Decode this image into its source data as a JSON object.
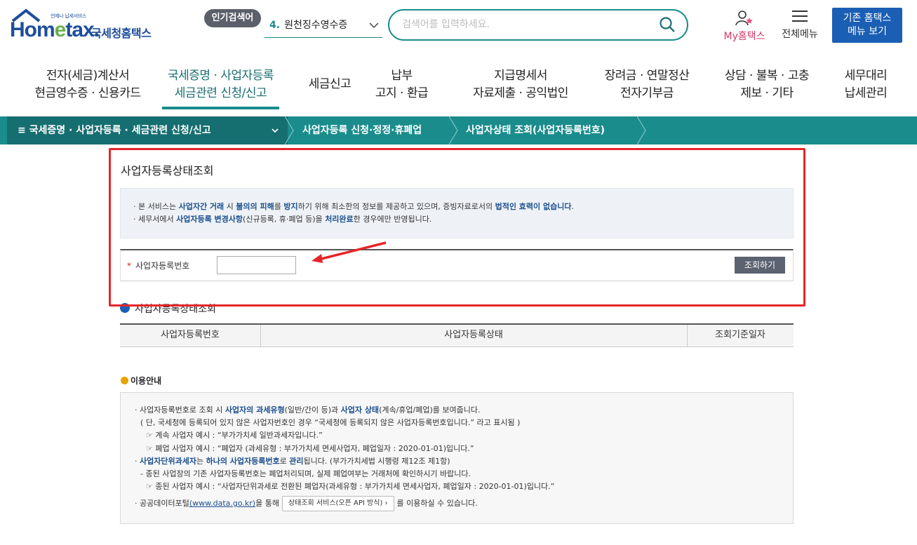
{
  "header": {
    "logo_tag": "언제나 납세서비스",
    "logo_name_1": "Hom",
    "logo_name_e": "e",
    "logo_name_2": "tax.",
    "logo_kr": "국세청홈택스",
    "popular_badge": "인기검색어",
    "popular_rank": "4.",
    "popular_term": "원천징수영수증",
    "search_placeholder": "검색어를 입력하세요.",
    "my_label": "My홈택스",
    "menu_label": "전체메뉴",
    "old_line1": "기존 홈택스",
    "old_line2": "메뉴 보기"
  },
  "nav": [
    {
      "l1": "전자(세금)계산서",
      "l2": "현금영수증 · 신용카드"
    },
    {
      "l1": "국세증명 · 사업자등록",
      "l2": "세금관련 신청/신고"
    },
    {
      "l1": "세금신고",
      "l2": ""
    },
    {
      "l1": "납부",
      "l2": "고지 · 환급"
    },
    {
      "l1": "지급명세서",
      "l2": "자료제출 · 공익법인"
    },
    {
      "l1": "장려금 · 연말정산",
      "l2": "전자기부금"
    },
    {
      "l1": "상담 · 불복 · 고충",
      "l2": "제보 · 기타"
    },
    {
      "l1": "세무대리",
      "l2": "납세관리"
    }
  ],
  "breadcrumb": {
    "menu": "≡  국세증명 · 사업자등록 · 세금관련 신청/신고",
    "b2": "사업자등록 신청·정정·휴폐업",
    "b3": "사업자상태 조회(사업자등록번호)"
  },
  "panel": {
    "title": "사업자등록상태조회",
    "n1_a": "본 서비스는 ",
    "n1_b": "사업자간 거래",
    "n1_c": " 시 ",
    "n1_d": "불의의 피해",
    "n1_e": "를 ",
    "n1_f": "방지",
    "n1_g": "하기 위해 최소한의 정보를 제공하고 있으며, 증빙자료로서의 ",
    "n1_h": "법적인 효력이 없습니다",
    "n1_i": ".",
    "n2_a": "세무서에서 ",
    "n2_b": "사업자등록 변경사항",
    "n2_c": "(신규등록, 휴·폐업 등)을 ",
    "n2_d": "처리완료",
    "n2_e": "한 경우에만 반영됩니다.",
    "field_label": "사업자등록번호",
    "field_value": "",
    "submit": "조회하기"
  },
  "result": {
    "title": "사업자등록상태조회",
    "headers": [
      "사업자등록번호",
      "사업자등록상태",
      "조회기준일자"
    ]
  },
  "usage": {
    "title": "이용안내",
    "l1_a": "사업자등록번호로 조회 시 ",
    "l1_b": "사업자의 과세유형",
    "l1_c": "(일반/간이 등)과 ",
    "l1_d": "사업자 상태",
    "l1_e": "(계속/휴업/폐업)를 보여줍니다.",
    "l2": "( 단, 국세청에 등록되어 있지 않은 사업자번호인 경우 “국세청에 등록되지 않은 사업자등록번호입니다.” 라고 표시됨 )",
    "l3": "☞ 계속 사업자 예시 : “부가가치세 일반과세자입니다.”",
    "l4": "☞ 폐업 사업자 예시 : “폐업자 (과세유형 : 부가가치세 면세사업자, 폐업일자 : 2020-01-01)입니다.”",
    "l5_a": "사업자단위과세자",
    "l5_b": "는 ",
    "l5_c": "하나의 사업자등록번호",
    "l5_d": "로 ",
    "l5_e": "관리",
    "l5_f": "됩니다. (부가가치세법 시행령 제12조 제1항)",
    "l6": "- 종된 사업장의 기존 사업자등록번호는 폐업처리되며, 실제 폐업여부는 거래처에 확인하시기 바랍니다.",
    "l7": "☞ 종된 사업자 예시 : “사업자단위과세로 전환된 폐업자(과세유형 : 부가가치세 면세사업자, 폐업일자 : 2020-01-01)입니다.”",
    "l8_a": "공공데이터포털",
    "l8_link": "(www.data.go.kr)",
    "l8_b": "을 통해",
    "l8_btn": "상태조회 서비스(오픈 API 방식)  ›",
    "l8_c": "를 이용하실 수 있습니다."
  },
  "colors": {
    "teal": "#1b8c8c",
    "teal_dark": "#156e70",
    "red": "#e5252a",
    "blue": "#1a5fb4"
  }
}
